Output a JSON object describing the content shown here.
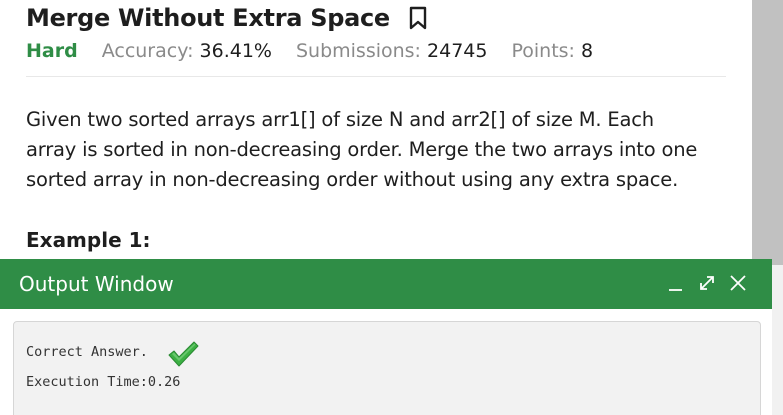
{
  "problem": {
    "title": "Merge Without Extra Space",
    "difficulty": "Hard",
    "accuracy_label": "Accuracy:",
    "accuracy_value": "36.41%",
    "submissions_label": "Submissions:",
    "submissions_value": "24745",
    "points_label": "Points:",
    "points_value": "8",
    "description_lines": [
      "Given two sorted arrays arr1[] of size N and arr2[] of size M. Each",
      "array is sorted in non-decreasing order. Merge the two arrays into one",
      "sorted array in non-decreasing order without using any extra space."
    ],
    "example_heading": "Example 1:"
  },
  "output_window": {
    "title": "Output Window",
    "controls": [
      "minimize-icon",
      "expand-icon",
      "close-icon"
    ],
    "result_text": "Correct Answer.",
    "execution_time": "Execution Time:0.26"
  },
  "colors": {
    "brand_green": "#2f8d46",
    "check_green": "#3cb043"
  }
}
